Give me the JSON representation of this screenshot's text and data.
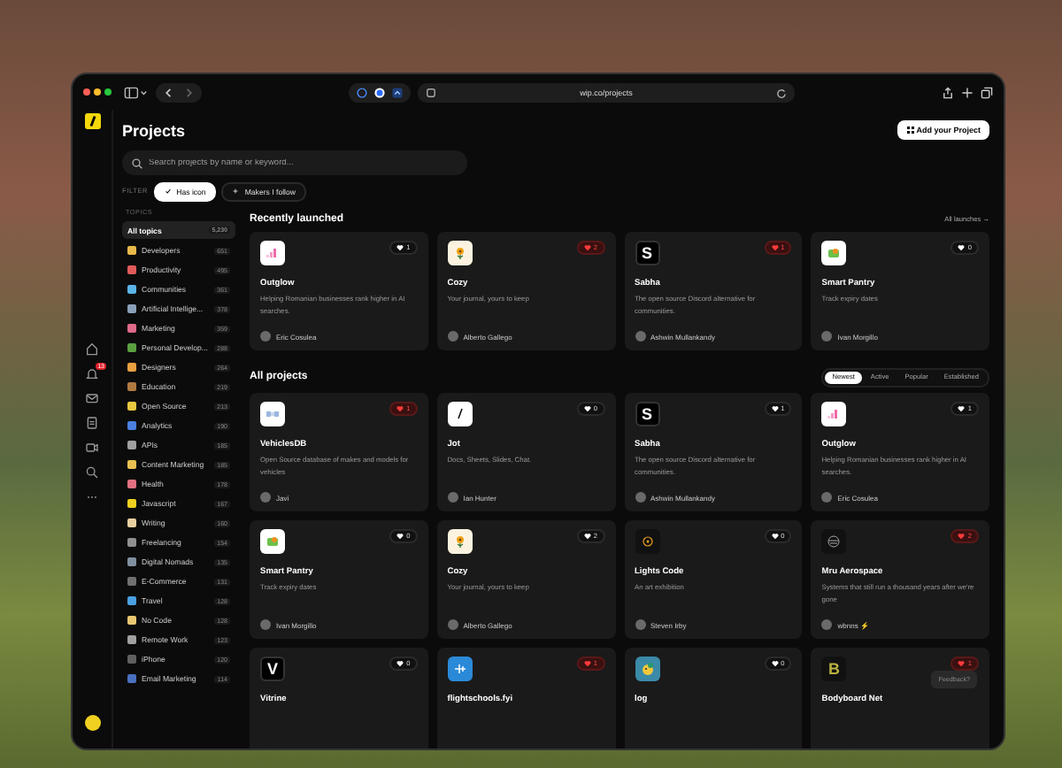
{
  "browser": {
    "url": "wip.co/projects"
  },
  "page": {
    "title": "Projects",
    "add_button": "Add your Project",
    "search": {
      "placeholder": "Search projects by name or keyword..."
    },
    "filter_label": "FILTER",
    "filters": [
      {
        "label": "Has icon",
        "selected": true
      },
      {
        "label": "Makers I follow",
        "selected": false
      }
    ]
  },
  "rail": {
    "notifications_badge": "13"
  },
  "topics": {
    "heading": "TOPICS",
    "items": [
      {
        "label": "All topics",
        "count": "5,230",
        "selected": true
      },
      {
        "label": "Developers",
        "count": "651",
        "selected": false,
        "color": "#e8b84a"
      },
      {
        "label": "Productivity",
        "count": "495",
        "selected": false,
        "color": "#e05a5a"
      },
      {
        "label": "Communities",
        "count": "361",
        "selected": false,
        "color": "#5ab4e8"
      },
      {
        "label": "Artificial Intellige...",
        "count": "378",
        "selected": false,
        "color": "#8aa0b8"
      },
      {
        "label": "Marketing",
        "count": "359",
        "selected": false,
        "color": "#e06a8a"
      },
      {
        "label": "Personal Develop...",
        "count": "288",
        "selected": false,
        "color": "#5aa040"
      },
      {
        "label": "Designers",
        "count": "264",
        "selected": false,
        "color": "#e8a040"
      },
      {
        "label": "Education",
        "count": "219",
        "selected": false,
        "color": "#b07a40"
      },
      {
        "label": "Open Source",
        "count": "213",
        "selected": false,
        "color": "#e8c840"
      },
      {
        "label": "Analytics",
        "count": "190",
        "selected": false,
        "color": "#4a80e0"
      },
      {
        "label": "APIs",
        "count": "185",
        "selected": false,
        "color": "#a0a0a0"
      },
      {
        "label": "Content Marketing",
        "count": "185",
        "selected": false,
        "color": "#e8c050"
      },
      {
        "label": "Health",
        "count": "178",
        "selected": false,
        "color": "#e07080"
      },
      {
        "label": "Javascript",
        "count": "167",
        "selected": false,
        "color": "#f0d020"
      },
      {
        "label": "Writing",
        "count": "160",
        "selected": false,
        "color": "#e8d0a0"
      },
      {
        "label": "Freelancing",
        "count": "154",
        "selected": false,
        "color": "#909090"
      },
      {
        "label": "Digital Nomads",
        "count": "135",
        "selected": false,
        "color": "#8090a0"
      },
      {
        "label": "E-Commerce",
        "count": "131",
        "selected": false,
        "color": "#707070"
      },
      {
        "label": "Travel",
        "count": "128",
        "selected": false,
        "color": "#4aa0e0"
      },
      {
        "label": "No Code",
        "count": "128",
        "selected": false,
        "color": "#e8c870"
      },
      {
        "label": "Remote Work",
        "count": "123",
        "selected": false,
        "color": "#a0a0a0"
      },
      {
        "label": "iPhone",
        "count": "120",
        "selected": false,
        "color": "#606060"
      },
      {
        "label": "Email Marketing",
        "count": "114",
        "selected": false,
        "color": "#4a70c0"
      }
    ]
  },
  "recently_launched": {
    "title": "Recently launched",
    "link": "All launches →",
    "projects": [
      {
        "kind": "bars",
        "name": "Outglow",
        "description": "Helping Romanian businesses rank higher in AI searches.",
        "author": "Eric Cosulea",
        "votes": "1",
        "voted": false
      },
      {
        "kind": "flower",
        "name": "Cozy",
        "description": "Your journal, yours to keep",
        "author": "Alberto Gallego",
        "votes": "2",
        "voted": true
      },
      {
        "kind": "letter",
        "logo_text": "S",
        "name": "Sabha",
        "description": "The open source Discord alternative for communities.",
        "author": "Ashwin Mullankandy",
        "votes": "1",
        "voted": true
      },
      {
        "kind": "pantry",
        "name": "Smart Pantry",
        "description": "Track expiry dates",
        "author": "Ivan Morgillo",
        "votes": "0",
        "voted": false
      }
    ]
  },
  "all_projects": {
    "title": "All projects",
    "sort_tabs": [
      {
        "label": "Newest",
        "selected": true
      },
      {
        "label": "Active",
        "selected": false
      },
      {
        "label": "Popular",
        "selected": false
      },
      {
        "label": "Established",
        "selected": false
      }
    ],
    "projects": [
      {
        "kind": "db",
        "name": "VehiclesDB",
        "description": "Open Source database of makes and models for vehicles",
        "author": "Javi",
        "votes": "1",
        "voted": true
      },
      {
        "kind": "pen",
        "name": "Jot",
        "description": "Docs, Sheets, Slides, Chat.",
        "author": "Ian Hunter",
        "votes": "0",
        "voted": false
      },
      {
        "kind": "letter",
        "logo_text": "S",
        "name": "Sabha",
        "description": "The open source Discord alternative for communities.",
        "author": "Ashwin Mullankandy",
        "votes": "1",
        "voted": false
      },
      {
        "kind": "bars",
        "name": "Outglow",
        "description": "Helping Romanian businesses rank higher in AI searches.",
        "author": "Eric Cosulea",
        "votes": "1",
        "voted": false
      },
      {
        "kind": "pantry",
        "name": "Smart Pantry",
        "description": "Track expiry dates",
        "author": "Ivan Morgillo",
        "votes": "0",
        "voted": false
      },
      {
        "kind": "flower",
        "name": "Cozy",
        "description": "Your journal, yours to keep",
        "author": "Alberto Gallego",
        "votes": "2",
        "voted": false
      },
      {
        "kind": "ring",
        "name": "Lights Code",
        "description": "An art exhibition",
        "author": "Steven Irby",
        "votes": "0",
        "voted": false
      },
      {
        "kind": "orbit",
        "name": "Mru Aerospace",
        "description": "Systems that still run a thousand years after we're gone",
        "author": "wbnns ⚡",
        "votes": "2",
        "voted": true
      },
      {
        "kind": "letter",
        "logo_text": "V",
        "name": "Vitrine",
        "votes": "0",
        "voted": false
      },
      {
        "kind": "plane",
        "name": "flightschools.fyi",
        "votes": "1",
        "voted": true
      },
      {
        "kind": "bird",
        "name": "log",
        "votes": "0",
        "voted": false
      },
      {
        "kind": "letter-olive",
        "logo_text": "B",
        "name": "Bodyboard Net",
        "votes": "1",
        "voted": true
      }
    ]
  },
  "feedback_button": "Feedback?"
}
